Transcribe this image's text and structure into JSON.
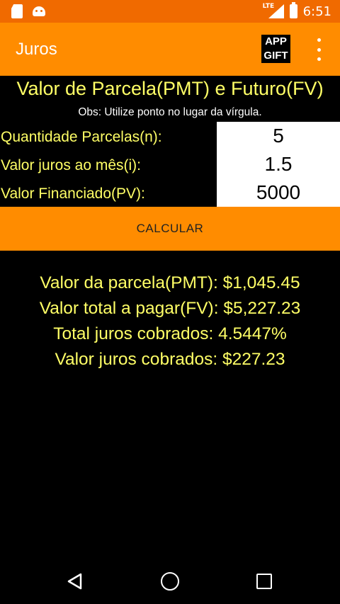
{
  "status_bar": {
    "network_label": "LTE",
    "time": "6:51",
    "left_icons": [
      "sd-card-icon",
      "android-icon"
    ],
    "right_icons": [
      "signal-icon",
      "battery-charging-icon"
    ]
  },
  "app_bar": {
    "title": "Juros",
    "badge_line1": "APP",
    "badge_line2": "GIFT",
    "menu_icon": "overflow-menu-icon"
  },
  "main": {
    "heading": "Valor de Parcela(PMT) e Futuro(FV)",
    "note": "Obs: Utilize ponto no lugar da vírgula.",
    "fields": [
      {
        "label": "Quantidade Parcelas(n):",
        "value": "5"
      },
      {
        "label": "Valor juros ao mês(i):",
        "value": "1.5"
      },
      {
        "label": "Valor Financiado(PV):",
        "value": "5000"
      }
    ],
    "calculate_label": "CALCULAR",
    "results": [
      "Valor da parcela(PMT): $1,045.45",
      "Valor total a pagar(FV): $5,227.23",
      "Total juros cobrados: 4.5447%",
      "Valor juros cobrados: $227.23"
    ]
  },
  "nav_bar": {
    "icons": [
      "back-icon",
      "home-icon",
      "recents-icon"
    ]
  },
  "colors": {
    "status_bar": "#F06A00",
    "app_bar": "#FF8C00",
    "accent_text": "#FFFF66",
    "background": "#000000"
  }
}
